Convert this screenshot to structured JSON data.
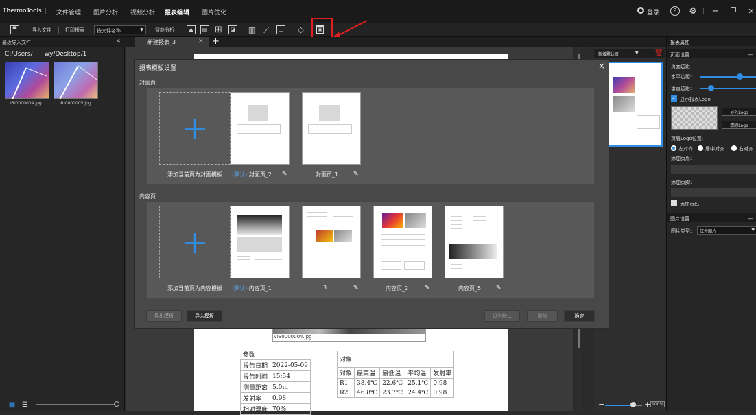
{
  "app": {
    "title": "ThermoTools"
  },
  "menu": [
    "文件管理",
    "图片分析",
    "视频分析",
    "报表编辑",
    "图片优化"
  ],
  "menu_active_index": 3,
  "account": {
    "login_label": "登录"
  },
  "toolbar": {
    "import_file": "导入文件",
    "print_report": "打印报表",
    "sort_select": "按文件名称",
    "smart_analysis": "智能分析"
  },
  "left_panel": {
    "header": "最近导入文件",
    "path": "C:/Users/      wy/Desktop/1",
    "files": [
      "IRI0000004.jpg",
      "IRI0000005.jpg"
    ]
  },
  "tabs": {
    "active": "新建报表_3",
    "close": "×",
    "add": "+"
  },
  "thumb_panel": {
    "select": "新增默认页"
  },
  "right_panel": {
    "header": "报表属性",
    "page_settings": "页面设置",
    "page_margin": "页面边距",
    "h_margin": "水平边距:",
    "v_margin": "垂直边距:",
    "h_margin_value": 0.7,
    "v_margin_value": 0.2,
    "show_logo": "显示报表Logo",
    "import_logo": "导入Logo",
    "clear_logo": "清除Logo",
    "logo_position": "页眉Logo位置:",
    "align_left": "左对齐",
    "align_center": "居中对齐",
    "align_right": "右对齐",
    "add_header": "添加页眉:",
    "add_footer": "添加页脚:",
    "add_page_number": "添加页码",
    "image_settings": "图片设置",
    "image_type_label": "图片类型:",
    "image_type_value": "红外图片"
  },
  "dialog": {
    "title": "报表模板设置",
    "close": "×",
    "cover_group": "封面页",
    "content_group": "内容页",
    "add_cover": "添加当前页为封面模板",
    "add_content": "添加当前页为内容模板",
    "default_tag": "(默认)",
    "cover_templates": [
      "封面页_2",
      "封面页_1"
    ],
    "content_templates": [
      "内容页_1",
      "3",
      "内容页_2",
      "内容页_5"
    ],
    "export_template": "导出模板",
    "import_template": "导入模板",
    "set_default": "设为默认",
    "delete": "删除",
    "confirm": "确定"
  },
  "report": {
    "image_caption": "VIS0000004.jpg",
    "params_title": "参数",
    "params": [
      [
        "报告日期",
        "2022-05-09"
      ],
      [
        "报告时间",
        "15:54"
      ],
      [
        "测量距离",
        "5.0m"
      ],
      [
        "发射率",
        "0.98"
      ],
      [
        "相对湿度",
        "70%"
      ]
    ],
    "objects_title": "对象",
    "object_headers": [
      "对象",
      "最高温",
      "最低温",
      "平均温",
      "发射率"
    ],
    "objects": [
      [
        "R1",
        "38.4℃",
        "22.6℃",
        "25.1℃",
        "0.98"
      ],
      [
        "R2",
        "46.8℃",
        "23.7℃",
        "24.4℃",
        "0.98"
      ]
    ]
  },
  "zoom": {
    "value": "100%",
    "minus": "−",
    "plus": "+"
  },
  "colors": {
    "accent": "#2f8de4",
    "annotation": "#e02020"
  }
}
